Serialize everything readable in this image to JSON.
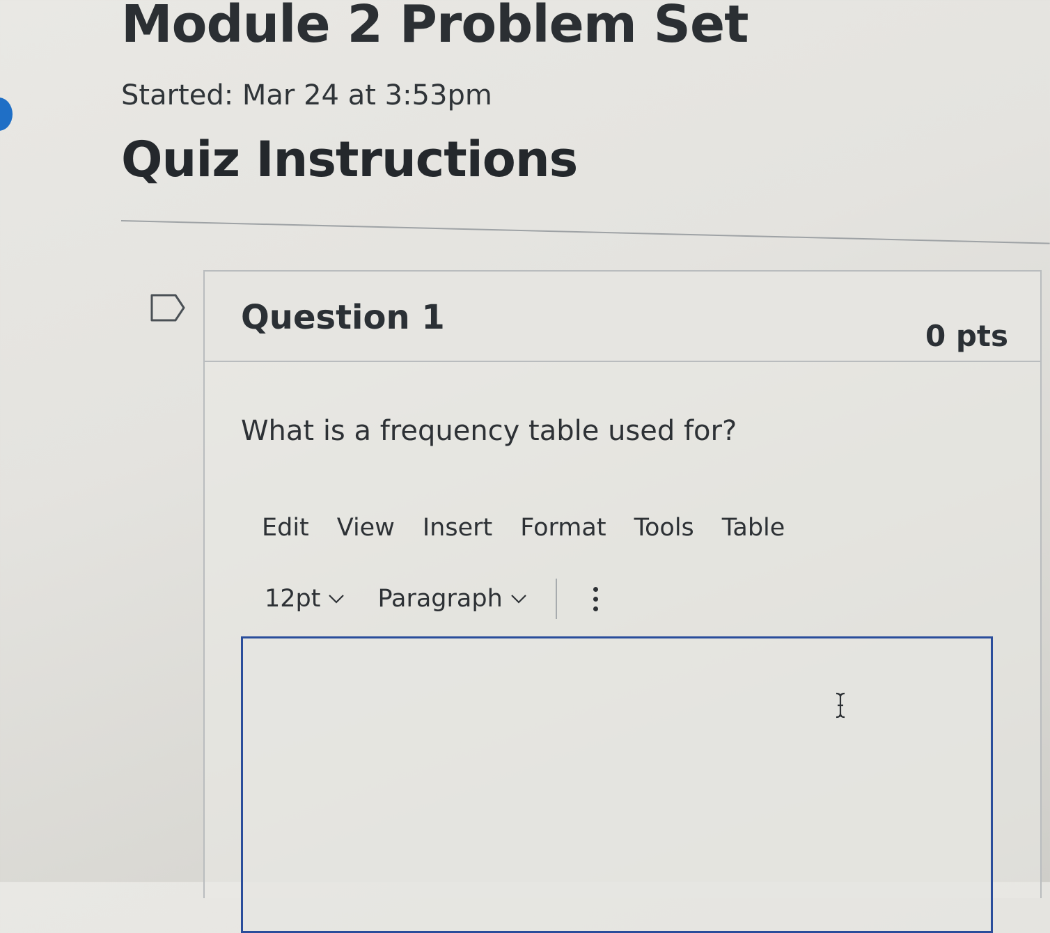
{
  "page": {
    "title": "Module 2 Problem Set",
    "started": "Started: Mar 24 at 3:53pm",
    "instructions_heading": "Quiz Instructions"
  },
  "question": {
    "title": "Question 1",
    "points": "0 pts",
    "text": "What is a frequency table used for?",
    "flag_icon": "flag-icon"
  },
  "editor": {
    "menu": [
      "Edit",
      "View",
      "Insert",
      "Format",
      "Tools",
      "Table"
    ],
    "font_size": "12pt",
    "block_format": "Paragraph",
    "more_icon": "more-vertical-icon",
    "content": ""
  },
  "colors": {
    "editor_border": "#2a4d9b",
    "indicator_dot": "#1f6fc6"
  }
}
